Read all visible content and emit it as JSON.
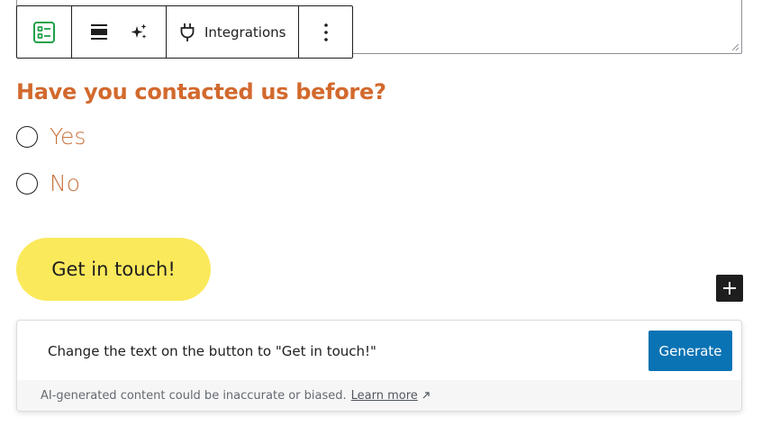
{
  "toolbar": {
    "form_icon": "form-icon",
    "align_icon": "align-icon",
    "ai_icon": "sparkles-icon",
    "integrations_icon": "plug-icon",
    "integrations_label": "Integrations",
    "more_icon": "more-vertical-icon"
  },
  "form": {
    "question": "Have you contacted us before?",
    "options": [
      {
        "label": "Yes"
      },
      {
        "label": "No"
      }
    ],
    "submit_label": "Get in touch!",
    "accent_color": "#d2692d",
    "button_color": "#fbe95c"
  },
  "add_block_icon": "plus-icon",
  "ai_panel": {
    "prompt": "Change the text on the button to \"Get in touch!\"",
    "generate_label": "Generate",
    "disclaimer": "AI-generated content could be inaccurate or biased.",
    "learn_more": "Learn more",
    "learn_more_icon": "external-link-icon",
    "button_color": "#0a73b4"
  }
}
